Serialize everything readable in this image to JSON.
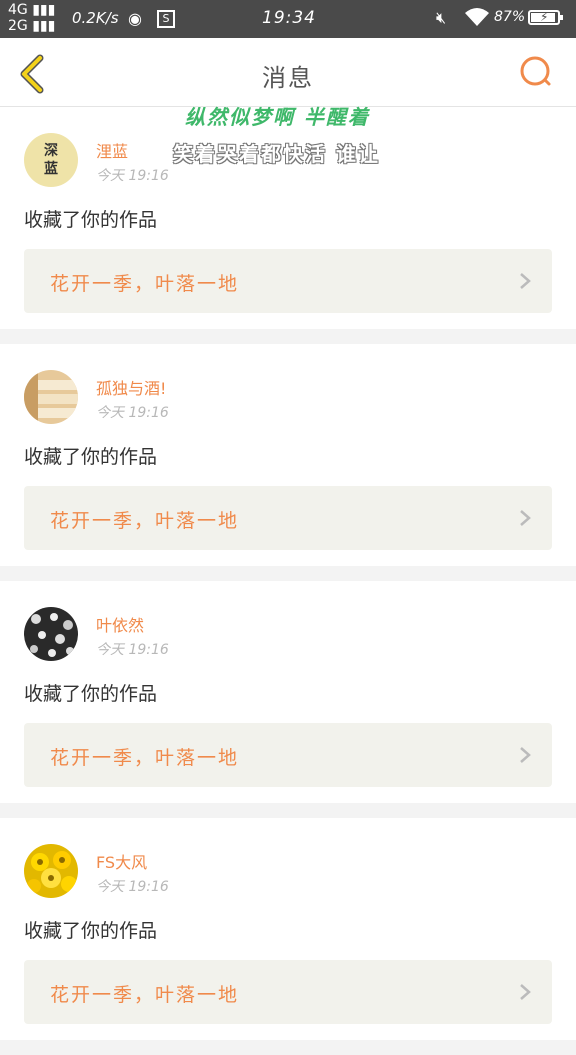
{
  "status_bar": {
    "network_top": "4G",
    "network_bottom": "2G",
    "speed": "0.2K/s",
    "s_badge": "S",
    "time": "19:34",
    "battery": "87%"
  },
  "header": {
    "title": "消息"
  },
  "overlay": {
    "line1": "纵然似梦啊 半醒着",
    "line2": "笑着哭着都快活 谁让"
  },
  "avatar_text": [
    "深",
    "蓝"
  ],
  "messages": [
    {
      "username": "浬蓝",
      "time": "今天 19:16",
      "action": "收藏了你的作品",
      "work_title": "花开一季，叶落一地"
    },
    {
      "username": "孤独与酒!",
      "time": "今天 19:16",
      "action": "收藏了你的作品",
      "work_title": "花开一季，叶落一地"
    },
    {
      "username": "叶依然",
      "time": "今天 19:16",
      "action": "收藏了你的作品",
      "work_title": "花开一季，叶落一地"
    },
    {
      "username": "FS大风",
      "time": "今天 19:16",
      "action": "收藏了你的作品",
      "work_title": "花开一季，叶落一地"
    }
  ],
  "colors": {
    "accent": "#f08a4b",
    "back_icon": "#e6c200",
    "status_bar": "#4a4a4a"
  }
}
